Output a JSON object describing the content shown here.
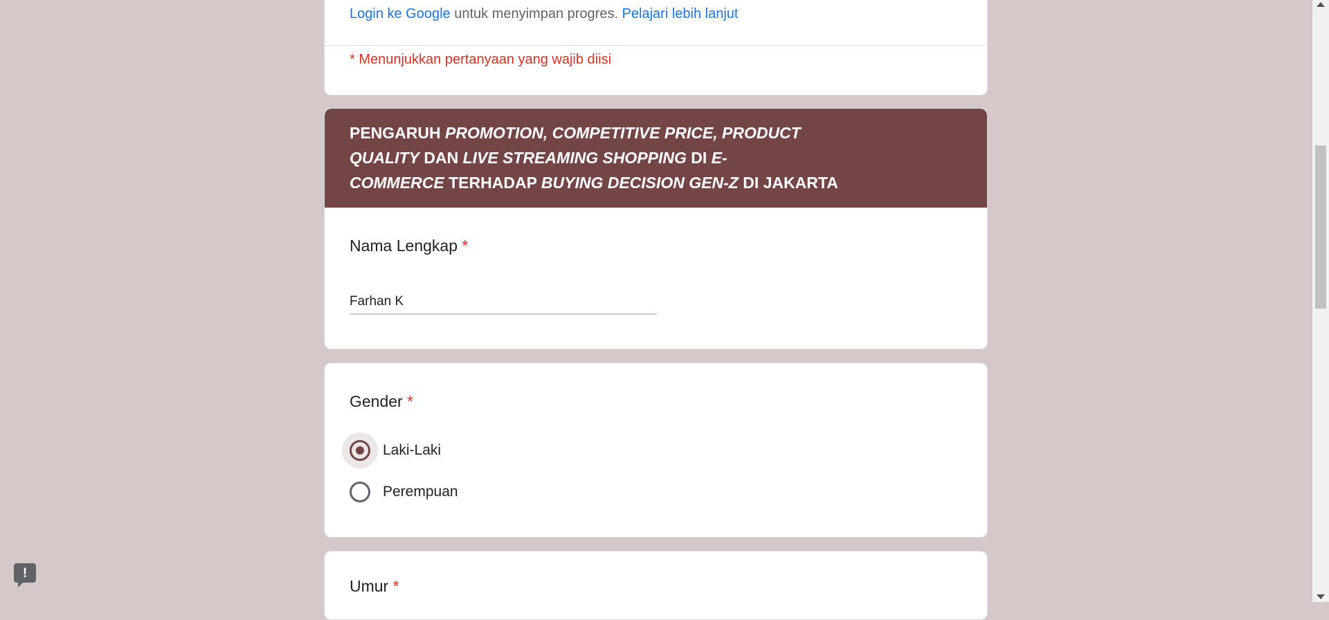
{
  "top": {
    "login_link": "Login ke Google",
    "save_text": " untuk menyimpan progres. ",
    "learn_link": "Pelajari lebih lanjut",
    "required_note": "* Menunjukkan pertanyaan yang wajib diisi"
  },
  "header": {
    "line1": {
      "a": "PENGARUH ",
      "b": "PROMOTION, COMPETITIVE PRICE,",
      "c": " ",
      "d": "PRODUCT"
    },
    "line2": {
      "a": "QUALITY",
      "b": " DAN ",
      "c": "LIVE STREAMING SHOPPING",
      "d": " DI ",
      "e": "E-"
    },
    "line3": {
      "a": "COMMERCE",
      "b": " TERHADAP ",
      "c": "BUYING DECISION GEN-Z",
      "d": " DI JAKARTA"
    }
  },
  "questions": {
    "nama": {
      "title": "Nama Lengkap",
      "required": "*",
      "value": "Farhan K"
    },
    "gender": {
      "title": "Gender",
      "required": "*",
      "options": [
        {
          "label": "Laki-Laki",
          "selected": true
        },
        {
          "label": "Perempuan",
          "selected": false
        }
      ]
    },
    "umur": {
      "title": "Umur",
      "required": "*"
    }
  },
  "colors": {
    "theme": "#744545",
    "background": "#d6c8c8",
    "required": "#d93025",
    "link": "#1a73e8"
  },
  "icons": {
    "report": "exclamation-icon"
  }
}
